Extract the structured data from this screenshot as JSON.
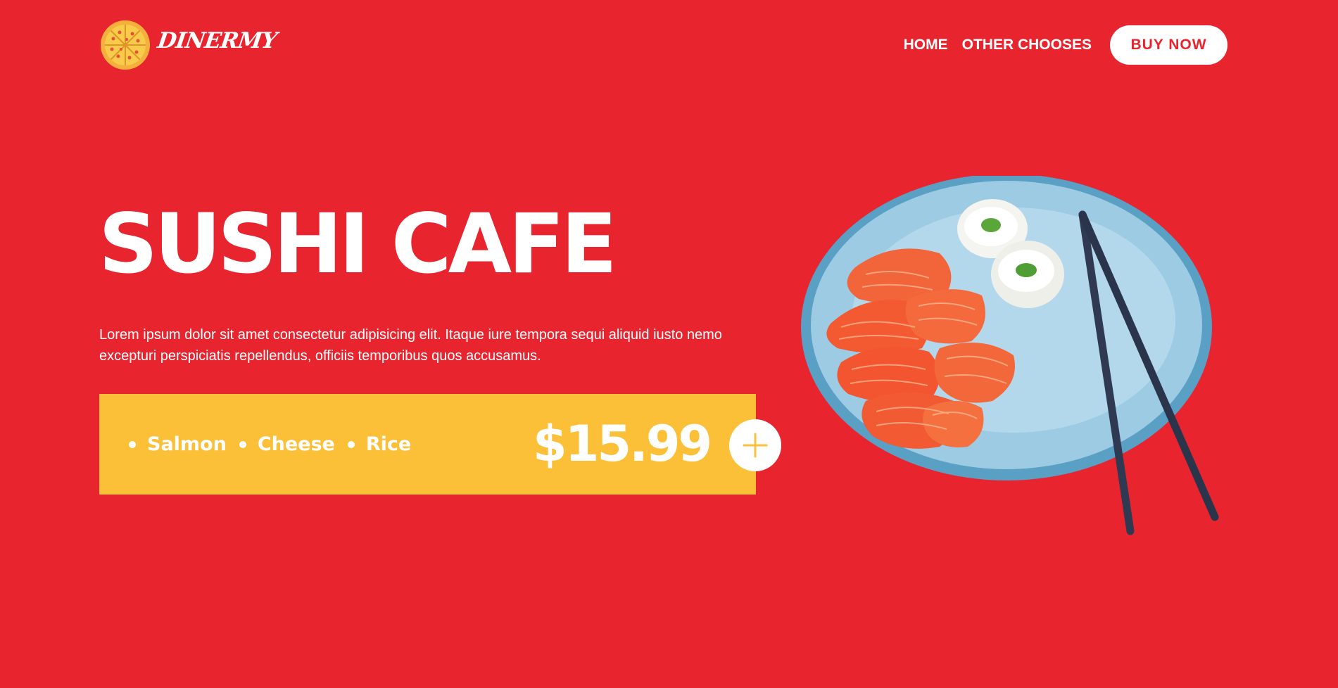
{
  "brand": {
    "name": "DinerMy",
    "logo_icon": "pizza-icon"
  },
  "nav": {
    "links": [
      {
        "label": "HOME"
      },
      {
        "label": "OTHER CHOOSES"
      }
    ],
    "cta_label": "BUY NOW"
  },
  "hero": {
    "title": "SUSHI CAFE",
    "description": "Lorem ipsum dolor sit amet consectetur adipisicing elit. Itaque iure tempora sequi aliquid iusto nemo excepturi perspiciatis repellendus, officiis temporibus quos accusamus.",
    "ingredients": [
      {
        "label": "Salmon"
      },
      {
        "label": "Cheese"
      },
      {
        "label": "Rice"
      }
    ],
    "price": "$15.99",
    "add_icon": "plus-icon",
    "image_icon": "sushi-plate-image"
  },
  "colors": {
    "background": "#e8252f",
    "accent": "#fbc037",
    "text": "#ffffff"
  }
}
